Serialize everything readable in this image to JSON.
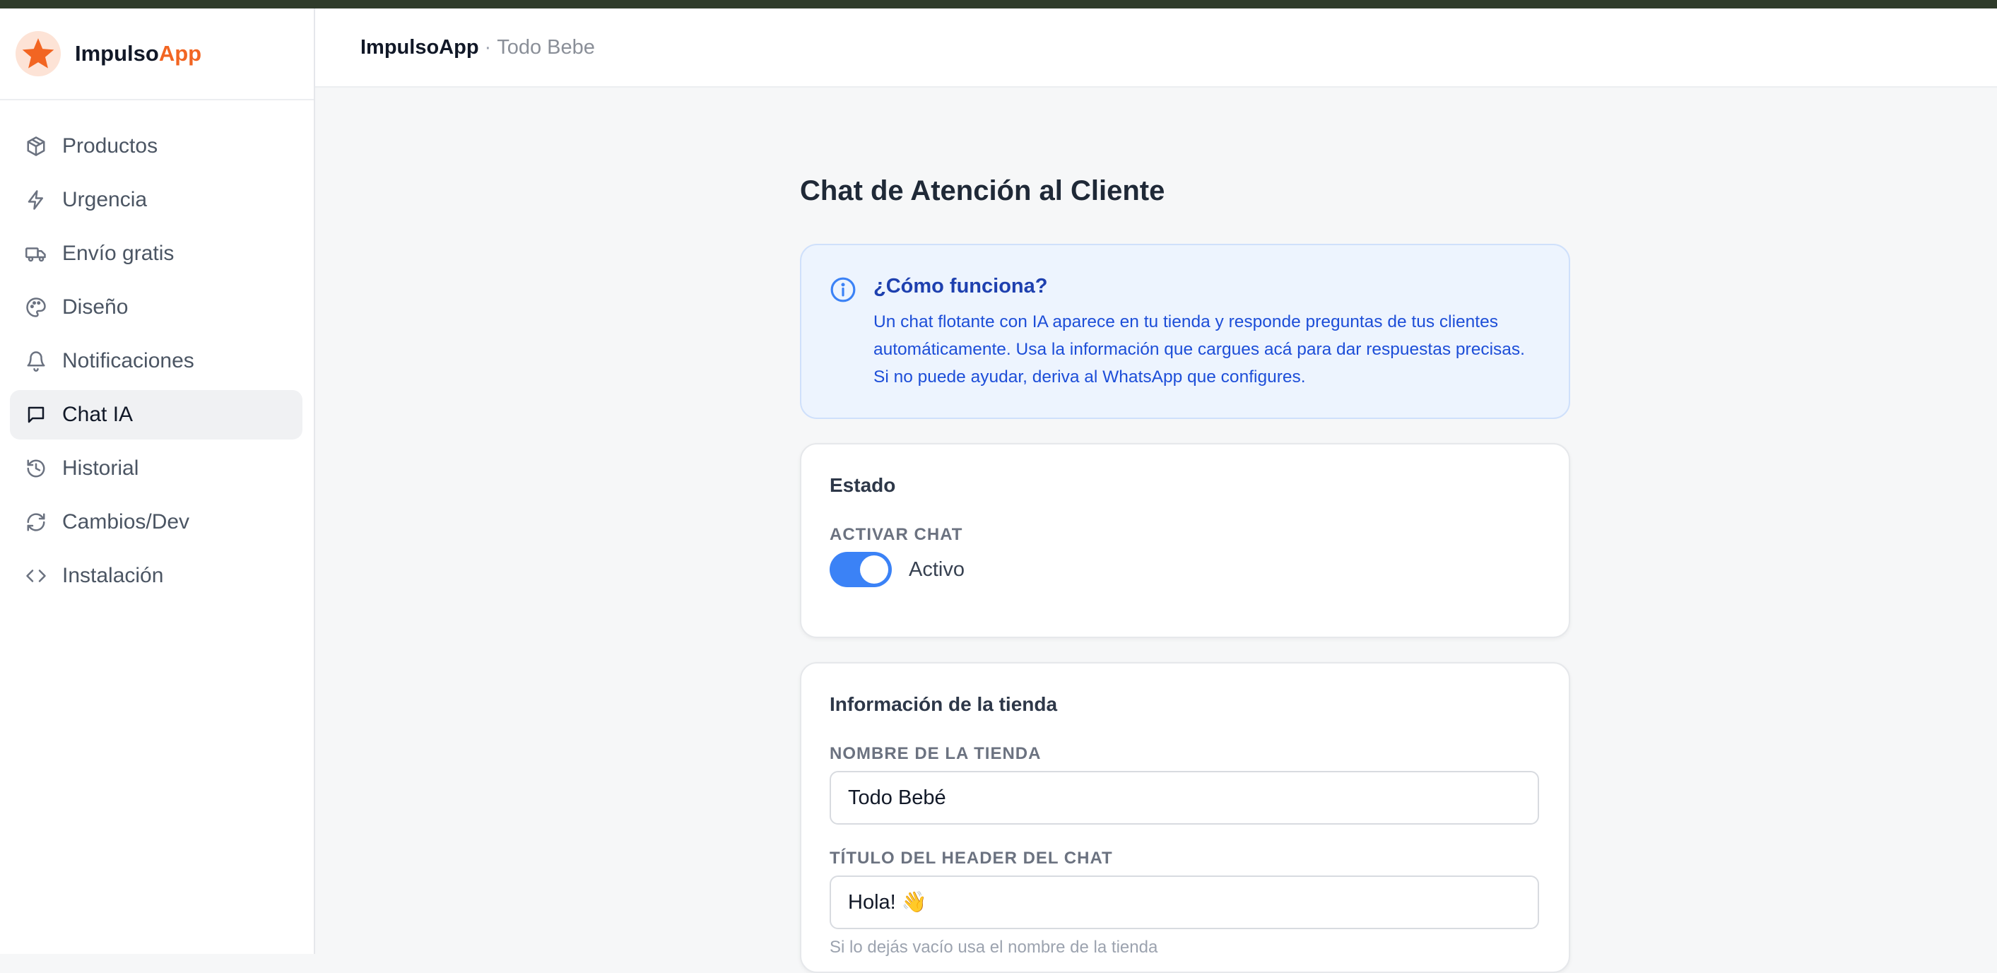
{
  "brand": {
    "name_main": "Impulso",
    "name_accent": "App",
    "accent_color": "#f26522"
  },
  "sidebar": {
    "items": [
      {
        "label": "Productos",
        "icon": "box-icon"
      },
      {
        "label": "Urgencia",
        "icon": "lightning-icon"
      },
      {
        "label": "Envío gratis",
        "icon": "truck-icon"
      },
      {
        "label": "Diseño",
        "icon": "palette-icon"
      },
      {
        "label": "Notificaciones",
        "icon": "bell-icon"
      },
      {
        "label": "Chat IA",
        "icon": "chat-icon",
        "active": true
      },
      {
        "label": "Historial",
        "icon": "history-icon"
      },
      {
        "label": "Cambios/Dev",
        "icon": "refresh-icon"
      },
      {
        "label": "Instalación",
        "icon": "code-icon"
      }
    ]
  },
  "header": {
    "app": "ImpulsoApp",
    "separator": "·",
    "store": "Todo Bebe"
  },
  "main": {
    "title": "Chat de Atención al Cliente",
    "info": {
      "title": "¿Cómo funciona?",
      "text": "Un chat flotante con IA aparece en tu tienda y responde preguntas de tus clientes automáticamente. Usa la información que cargues acá para dar respuestas precisas. Si no puede ayudar, deriva al WhatsApp que configures."
    },
    "estado": {
      "title": "Estado",
      "label": "ACTIVAR CHAT",
      "toggle_on": true,
      "toggle_text": "Activo"
    },
    "tienda": {
      "title": "Información de la tienda",
      "name_label": "NOMBRE DE LA TIENDA",
      "name_value": "Todo Bebé",
      "header_label": "TÍTULO DEL HEADER DEL CHAT",
      "header_value": "Hola! 👋",
      "header_hint": "Si lo dejás vacío usa el nombre de la tienda"
    }
  },
  "colors": {
    "primary": "#3b82f6",
    "info_bg": "#edf4fe",
    "info_text": "#1d4ed8"
  }
}
